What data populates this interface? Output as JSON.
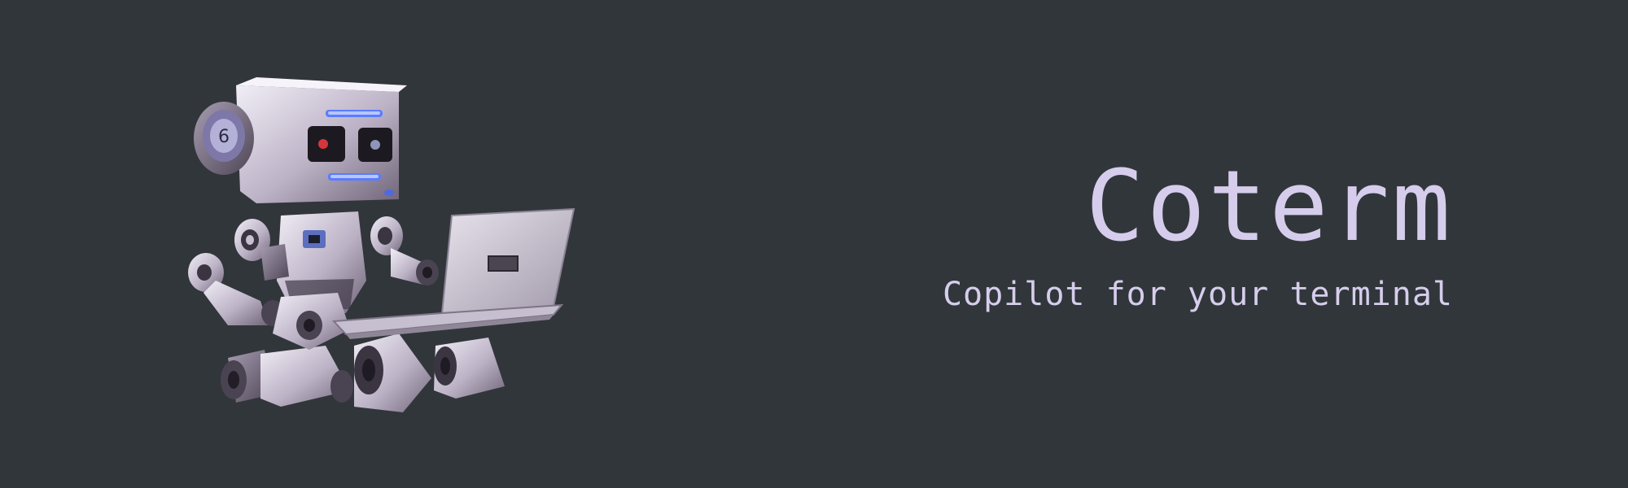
{
  "banner": {
    "title": "Coterm",
    "tagline": "Copilot for your terminal",
    "background_color": "#31363b",
    "text_color": "#d6cdec",
    "mascot_icon": "robot-with-laptop-icon"
  }
}
